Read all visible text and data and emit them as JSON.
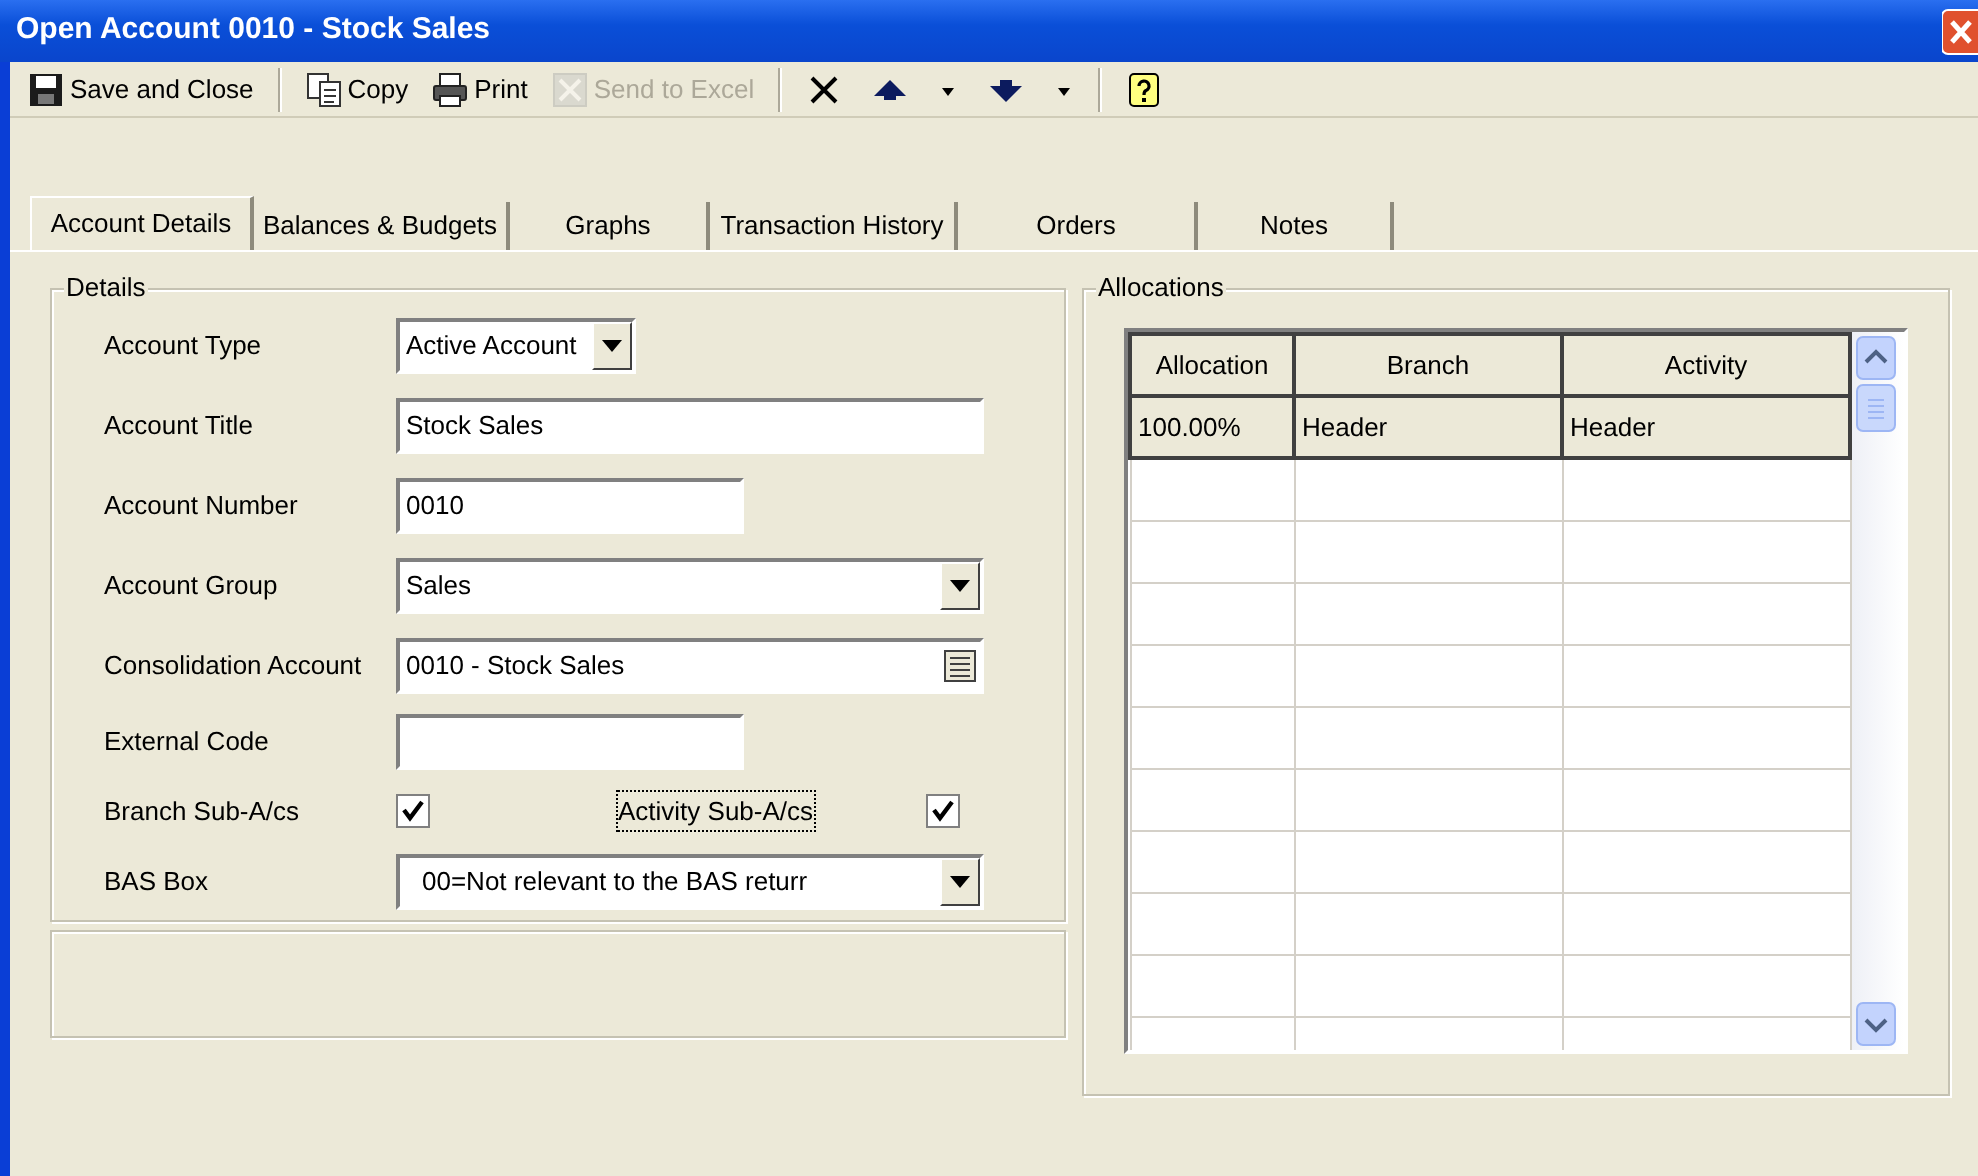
{
  "window": {
    "title": "Open Account 0010 - Stock Sales"
  },
  "toolbar": [
    {
      "kind": "save",
      "label": "Save and Close",
      "disabled": false
    },
    {
      "kind": "separator"
    },
    {
      "kind": "copy",
      "label": "Copy",
      "disabled": false
    },
    {
      "kind": "print",
      "label": "Print",
      "disabled": false
    },
    {
      "kind": "excel",
      "label": "Send to Excel",
      "disabled": true
    },
    {
      "kind": "separator"
    },
    {
      "kind": "delete",
      "disabled": false
    },
    {
      "kind": "up",
      "disabled": false
    },
    {
      "kind": "caret",
      "disabled": false
    },
    {
      "kind": "down",
      "disabled": false
    },
    {
      "kind": "caret",
      "disabled": false
    },
    {
      "kind": "separator"
    },
    {
      "kind": "help",
      "disabled": false
    }
  ],
  "tabs": [
    {
      "label": "Account Details",
      "selected": true
    },
    {
      "label": "Balances & Budgets",
      "selected": false
    },
    {
      "label": "Graphs",
      "selected": false
    },
    {
      "label": "Transaction History",
      "selected": false
    },
    {
      "label": "Orders",
      "selected": false
    },
    {
      "label": "Notes",
      "selected": false
    }
  ],
  "details": {
    "title": "Details",
    "fields": [
      {
        "kind": "select",
        "label": "Account Type",
        "value": "Active Account"
      },
      {
        "kind": "text",
        "label": "Account Title",
        "value": "Stock Sales"
      },
      {
        "kind": "text",
        "label": "Account Number",
        "value": "0010"
      },
      {
        "kind": "select",
        "label": "Account Group",
        "value": "Sales"
      },
      {
        "kind": "lookup",
        "label": "Consolidation Account",
        "value": "0010 - Stock Sales"
      },
      {
        "kind": "text",
        "label": "External Code"
      },
      {
        "kind": "checks",
        "items": [
          {
            "label": "Branch Sub-A/cs",
            "checked": true,
            "focused": false
          },
          {
            "label": "Activity Sub-A/cs",
            "checked": true,
            "focused": true
          }
        ]
      },
      {
        "kind": "select",
        "label": "BAS Box",
        "value": "00=Not relevant to the BAS returr"
      }
    ]
  },
  "allocations": {
    "title": "Allocations",
    "columns": [
      "Allocation",
      "Branch",
      "Activity"
    ],
    "rows": [
      [
        "100.00%",
        "Header",
        "Header"
      ]
    ]
  }
}
